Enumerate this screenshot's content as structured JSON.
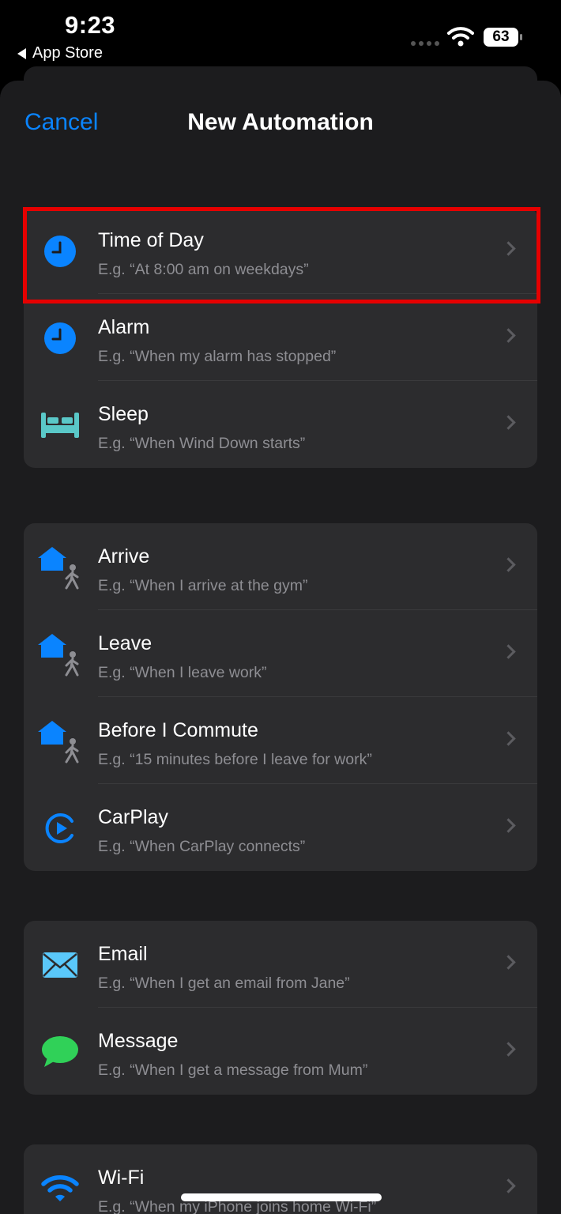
{
  "status_bar": {
    "time": "9:23",
    "back_label": "App Store",
    "battery": "63"
  },
  "nav": {
    "cancel_label": "Cancel",
    "title": "New Automation"
  },
  "colors": {
    "accent": "#0a84ff",
    "highlight": "#e60000",
    "green": "#30d158",
    "teal": "#5ac8c8"
  },
  "groups": [
    {
      "items": [
        {
          "icon": "clock-icon",
          "label": "Time of Day",
          "subtitle": "E.g. “At 8:00 am on weekdays”"
        },
        {
          "icon": "clock-icon",
          "label": "Alarm",
          "subtitle": "E.g. “When my alarm has stopped”"
        },
        {
          "icon": "bed-icon",
          "label": "Sleep",
          "subtitle": "E.g. “When Wind Down starts”"
        }
      ]
    },
    {
      "items": [
        {
          "icon": "house-person-icon",
          "label": "Arrive",
          "subtitle": "E.g. “When I arrive at the gym”"
        },
        {
          "icon": "house-person-icon",
          "label": "Leave",
          "subtitle": "E.g. “When I leave work”"
        },
        {
          "icon": "house-person-icon",
          "label": "Before I Commute",
          "subtitle": "E.g. “15 minutes before I leave for work”"
        },
        {
          "icon": "carplay-icon",
          "label": "CarPlay",
          "subtitle": "E.g. “When CarPlay connects”"
        }
      ]
    },
    {
      "items": [
        {
          "icon": "envelope-icon",
          "label": "Email",
          "subtitle": "E.g. “When I get an email from Jane”"
        },
        {
          "icon": "message-bubble-icon",
          "label": "Message",
          "subtitle": "E.g. “When I get a message from Mum”"
        }
      ]
    },
    {
      "items": [
        {
          "icon": "wifi-icon",
          "label": "Wi-Fi",
          "subtitle": "E.g. “When my iPhone joins home Wi-Fi”"
        }
      ]
    }
  ]
}
